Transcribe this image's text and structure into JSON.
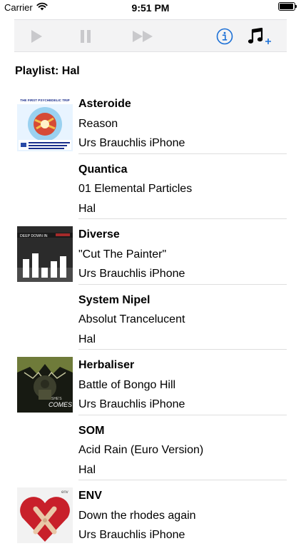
{
  "status": {
    "carrier": "Carrier",
    "time": "9:51 PM"
  },
  "toolbar": {
    "play_icon": "play-icon",
    "pause_icon": "pause-icon",
    "fast_forward_icon": "fast-forward-icon",
    "info_icon": "info-icon",
    "add_music_icon": "add-music-icon",
    "accent_color": "#1a6fd6",
    "disabled_color": "#c9c9cc"
  },
  "playlist": {
    "title": "Playlist: Hal"
  },
  "tracks": [
    {
      "title": "Asteroide",
      "album": "Reason",
      "source": "Urs Brauchlis iPhone",
      "artwork": "psychedelic-trip-cover",
      "artwork_lines": [
        "THE FIRST PSYCHEDELIC TRIP"
      ]
    },
    {
      "title": "Quantica",
      "album": "01 Elemental Particles",
      "source": "Hal",
      "artwork": ""
    },
    {
      "title": "Diverse",
      "album": "\"Cut The Painter\"",
      "source": "Urs Brauchlis iPhone",
      "artwork": "deep-down-cover",
      "artwork_lines": [
        "DEEP DOWN IN"
      ]
    },
    {
      "title": "System Nipel",
      "album": "Absolut Trancelucent",
      "source": "Hal",
      "artwork": ""
    },
    {
      "title": "Herbaliser",
      "album": "Battle of Bongo Hill",
      "source": "Urs Brauchlis iPhone",
      "artwork": "herbaliser-cover",
      "artwork_lines": [
        "SHE'S",
        "COMES"
      ]
    },
    {
      "title": "SOM",
      "album": "Acid Rain (Euro Version)",
      "source": "Hal",
      "artwork": ""
    },
    {
      "title": "ENV",
      "album": "Down the rhodes again",
      "source": "Urs Brauchlis iPhone",
      "artwork": "broken-heart-cover",
      "artwork_lines": [
        "env"
      ]
    }
  ]
}
